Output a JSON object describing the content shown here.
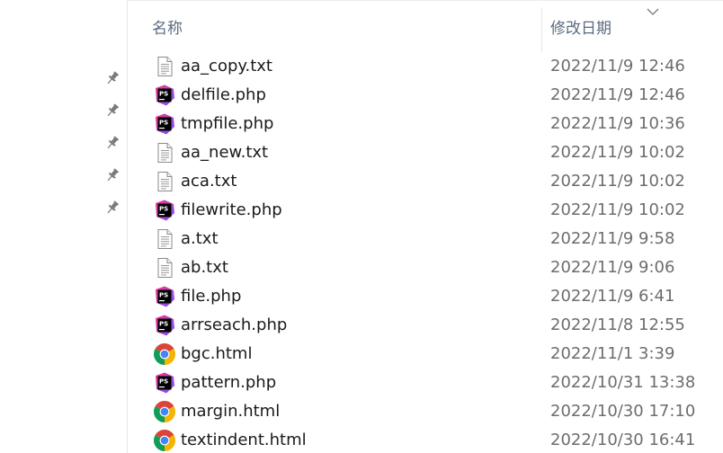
{
  "columns": {
    "name": "名称",
    "date_modified": "修改日期"
  },
  "files": [
    {
      "name": "aa_copy.txt",
      "modified": "2022/11/9 12:46",
      "icon": "text-file-icon"
    },
    {
      "name": "delfile.php",
      "modified": "2022/11/9 12:46",
      "icon": "phpstorm-file-icon"
    },
    {
      "name": "tmpfile.php",
      "modified": "2022/11/9 10:36",
      "icon": "phpstorm-file-icon"
    },
    {
      "name": "aa_new.txt",
      "modified": "2022/11/9 10:02",
      "icon": "text-file-icon"
    },
    {
      "name": "aca.txt",
      "modified": "2022/11/9 10:02",
      "icon": "text-file-icon"
    },
    {
      "name": "filewrite.php",
      "modified": "2022/11/9 10:02",
      "icon": "phpstorm-file-icon"
    },
    {
      "name": "a.txt",
      "modified": "2022/11/9 9:58",
      "icon": "text-file-icon"
    },
    {
      "name": "ab.txt",
      "modified": "2022/11/9 9:06",
      "icon": "text-file-icon"
    },
    {
      "name": "file.php",
      "modified": "2022/11/9 6:41",
      "icon": "phpstorm-file-icon"
    },
    {
      "name": "arrseach.php",
      "modified": "2022/11/8 12:55",
      "icon": "phpstorm-file-icon"
    },
    {
      "name": "bgc.html",
      "modified": "2022/11/1 3:39",
      "icon": "chrome-file-icon"
    },
    {
      "name": "pattern.php",
      "modified": "2022/10/31 13:38",
      "icon": "phpstorm-file-icon"
    },
    {
      "name": "margin.html",
      "modified": "2022/10/30 17:10",
      "icon": "chrome-file-icon"
    },
    {
      "name": "textindent.html",
      "modified": "2022/10/30 16:41",
      "icon": "chrome-file-icon"
    }
  ],
  "quick_access_pins": 5,
  "icons": {
    "pin": "pin-icon",
    "sort": "chevron-down-icon"
  },
  "colors": {
    "header_text": "#5b6b80",
    "file_text": "#1a1a1a",
    "date_text": "#6d6d6d",
    "phpstorm_gradient_start": "#ff318c",
    "phpstorm_gradient_end": "#6b57ff"
  }
}
